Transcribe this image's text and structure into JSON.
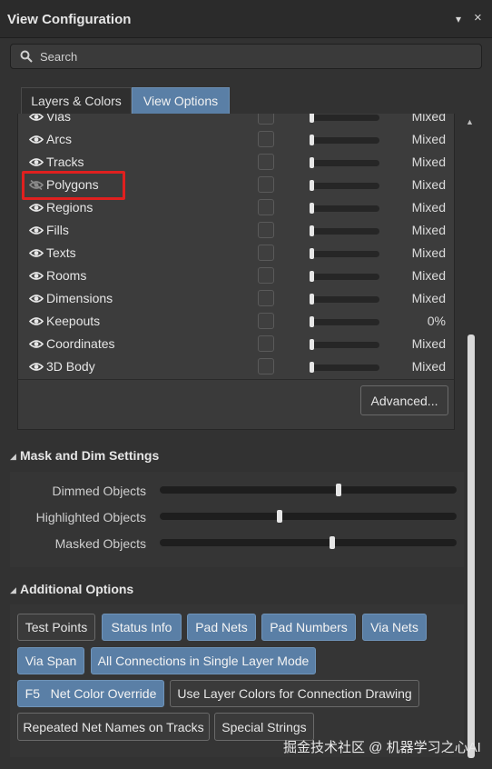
{
  "window": {
    "title": "View Configuration",
    "pin_glyph": "▾",
    "close_glyph": "×"
  },
  "search": {
    "placeholder": "Search"
  },
  "tabs": [
    {
      "label": "Layers & Colors",
      "active": false
    },
    {
      "label": "View Options",
      "active": true
    }
  ],
  "object_visibility": {
    "rows": [
      {
        "label": "Vias",
        "visible": true,
        "value": "Mixed"
      },
      {
        "label": "Arcs",
        "visible": true,
        "value": "Mixed"
      },
      {
        "label": "Tracks",
        "visible": true,
        "value": "Mixed"
      },
      {
        "label": "Polygons",
        "visible": false,
        "value": "Mixed",
        "highlighted": true
      },
      {
        "label": "Regions",
        "visible": true,
        "value": "Mixed"
      },
      {
        "label": "Fills",
        "visible": true,
        "value": "Mixed"
      },
      {
        "label": "Texts",
        "visible": true,
        "value": "Mixed"
      },
      {
        "label": "Rooms",
        "visible": true,
        "value": "Mixed"
      },
      {
        "label": "Dimensions",
        "visible": true,
        "value": "Mixed"
      },
      {
        "label": "Keepouts",
        "visible": true,
        "value": "0%"
      },
      {
        "label": "Coordinates",
        "visible": true,
        "value": "Mixed"
      },
      {
        "label": "3D Body",
        "visible": true,
        "value": "Mixed"
      }
    ],
    "advanced_button": "Advanced..."
  },
  "mask_dim": {
    "title": "Mask and Dim Settings",
    "sliders": [
      {
        "label": "Dimmed Objects",
        "level": 0.6
      },
      {
        "label": "Highlighted Objects",
        "level": 0.4
      },
      {
        "label": "Masked Objects",
        "level": 0.58
      }
    ]
  },
  "additional": {
    "title": "Additional Options",
    "buttons": [
      {
        "label": "Test Points",
        "active": false
      },
      {
        "label": "Status Info",
        "active": true
      },
      {
        "label": "Pad Nets",
        "active": true
      },
      {
        "label": "Pad Numbers",
        "active": true
      },
      {
        "label": "Via Nets",
        "active": true
      },
      {
        "label": "Via Span",
        "active": true
      },
      {
        "label": "All Connections in Single Layer Mode",
        "active": true
      },
      {
        "label": "F5   Net Color Override",
        "active": true
      },
      {
        "label": "Use Layer Colors for Connection Drawing",
        "active": false
      },
      {
        "label": "Repeated Net Names on Tracks",
        "active": false
      },
      {
        "label": "Special Strings",
        "active": false
      }
    ]
  },
  "watermark": "掘金技术社区 @ 机器学习之心AI",
  "colors": {
    "active_button": "#5a7fa6",
    "highlight_box": "#e0201f",
    "panel_bg": "#323232"
  }
}
